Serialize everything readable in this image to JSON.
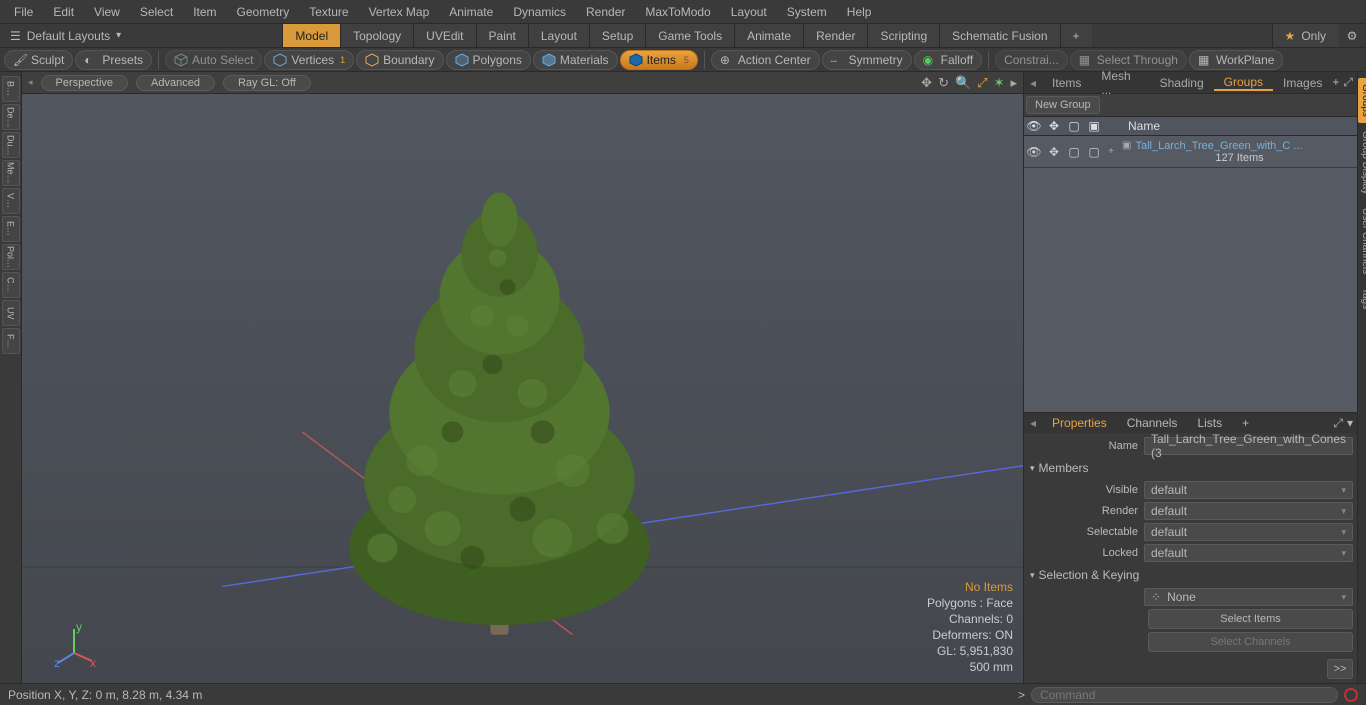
{
  "menu": [
    "File",
    "Edit",
    "View",
    "Select",
    "Item",
    "Geometry",
    "Texture",
    "Vertex Map",
    "Animate",
    "Dynamics",
    "Render",
    "MaxToModo",
    "Layout",
    "System",
    "Help"
  ],
  "layoutbar": {
    "default": "Default Layouts",
    "tabs": [
      "Model",
      "Topology",
      "UVEdit",
      "Paint",
      "Layout",
      "Setup",
      "Game Tools",
      "Animate",
      "Render",
      "Scripting",
      "Schematic Fusion"
    ],
    "active_tab": "Model",
    "plus": "+",
    "only": "Only"
  },
  "toolbar": {
    "sculpt": "Sculpt",
    "presets": "Presets",
    "autoselect": "Auto Select",
    "vertices": "Vertices",
    "vertices_badge": "1",
    "boundary": "Boundary",
    "polygons": "Polygons",
    "materials": "Materials",
    "items": "Items",
    "items_badge": "5",
    "actioncenter": "Action Center",
    "symmetry": "Symmetry",
    "falloff": "Falloff",
    "constraints": "Constrai...",
    "selectthrough": "Select Through",
    "workplane": "WorkPlane"
  },
  "lefttools": [
    "B…",
    "De…",
    "Du…",
    "Me…",
    "V…",
    "E…",
    "Pol…",
    "C…",
    "UV",
    "F…"
  ],
  "viewport": {
    "perspective": "Perspective",
    "advanced": "Advanced",
    "raygl": "Ray GL: Off",
    "stats": {
      "noitems": "No Items",
      "polygons": "Polygons : Face",
      "channels": "Channels: 0",
      "deformers": "Deformers: ON",
      "gl": "GL: 5,951,830",
      "grid": "500 mm"
    }
  },
  "rightTop": {
    "tabs": [
      "Items",
      "Mesh ...",
      "Shading",
      "Groups",
      "Images"
    ],
    "active": "Groups",
    "newgroup": "New Group",
    "nameCol": "Name",
    "row": {
      "name": "Tall_Larch_Tree_Green_with_C ...",
      "count": "127 Items"
    }
  },
  "props": {
    "tabs": [
      "Properties",
      "Channels",
      "Lists",
      "+"
    ],
    "active": "Properties",
    "name_label": "Name",
    "name_value": "Tall_Larch_Tree_Green_with_Cones (3",
    "members": "Members",
    "visible": "Visible",
    "render": "Render",
    "selectable": "Selectable",
    "locked": "Locked",
    "default": "default",
    "selkey": "Selection & Keying",
    "none": "None",
    "selectitems": "Select Items",
    "selectchannels": "Select Channels",
    "send": ">>"
  },
  "rightSide": [
    "Groups",
    "Group Display",
    "User Channels",
    "Tags"
  ],
  "rightSideActive": "Groups",
  "status": {
    "pos": "Position X, Y, Z:   0 m, 8.28 m, 4.34 m",
    "cmd": "Command",
    "prompt": ">"
  }
}
